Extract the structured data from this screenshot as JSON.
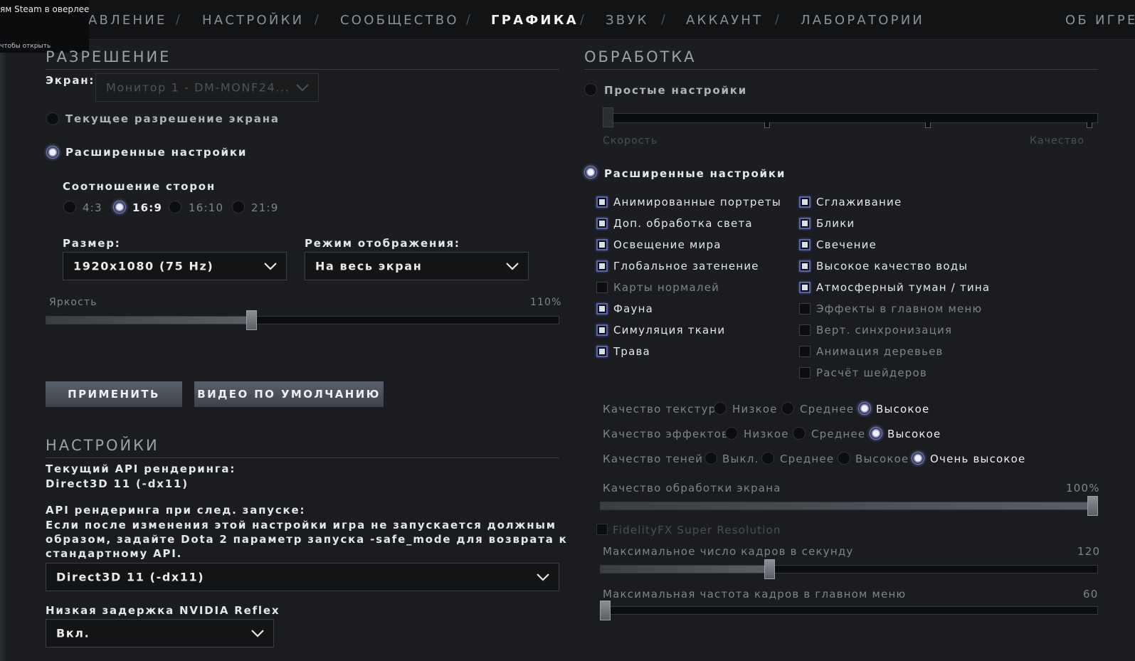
{
  "overlay": {
    "notice": "ям Steam в оверлее",
    "hint": "чтобы открыть"
  },
  "nav": {
    "items": [
      "АВЛЕНИЕ",
      "НАСТРОЙКИ",
      "СООБЩЕСТВО",
      "ГРАФИКА",
      "ЗВУК",
      "АККАУНТ",
      "ЛАБОРАТОРИИ"
    ],
    "separator": "/",
    "active": "ГРАФИКА",
    "about": "ОБ ИГРЕ"
  },
  "resolution": {
    "title": "РАЗРЕШЕНИЕ",
    "screen_label": "Экран:",
    "screen_value": "Монитор 1 - DM-MONF24...",
    "current_res": "Текущее разрешение экрана",
    "advanced": "Расширенные настройки",
    "aspect_label": "Соотношение сторон",
    "aspects": [
      "4:3",
      "16:9",
      "16:10",
      "21:9"
    ],
    "aspect_selected": "16:9",
    "size_label": "Размер:",
    "size_value": "1920x1080 (75 Hz)",
    "mode_label": "Режим отображения:",
    "mode_value": "На весь экран",
    "brightness_label": "Яркость",
    "brightness_value": "110%",
    "brightness_fraction": 0.4,
    "apply": "ПРИМЕНИТЬ",
    "defaults": "ВИДЕО ПО УМОЛЧАНИЮ"
  },
  "settings": {
    "title": "НАСТРОЙКИ",
    "api_current_label": "Текущий API рендеринга:",
    "api_current_value": "Direct3D 11 (-dx11)",
    "api_next_label": "API рендеринга при след. запуске:",
    "api_warning_1": "Если после изменения этой настройки игра не запускается должным",
    "api_warning_2": "образом, задайте Dota 2 параметр запуска -safe_mode для возврата к",
    "api_warning_3": "стандартному API.",
    "api_select": "Direct3D 11 (-dx11)",
    "reflex_label": "Низкая задержка NVIDIA Reflex",
    "reflex_value": "Вкл."
  },
  "rendering": {
    "title": "ОБРАБОТКА",
    "simple": "Простые настройки",
    "speed": "Скорость",
    "quality": "Качество",
    "advanced": "Расширенные настройки",
    "left_checks": [
      {
        "label": "Анимированные портреты",
        "checked": true
      },
      {
        "label": "Доп. обработка света",
        "checked": true
      },
      {
        "label": "Освещение мира",
        "checked": true
      },
      {
        "label": "Глобальное затенение",
        "checked": true
      },
      {
        "label": "Карты нормалей",
        "checked": false
      },
      {
        "label": "Фауна",
        "checked": true
      },
      {
        "label": "Симуляция ткани",
        "checked": true
      },
      {
        "label": "Трава",
        "checked": true
      }
    ],
    "right_checks": [
      {
        "label": "Сглаживание",
        "checked": true
      },
      {
        "label": "Блики",
        "checked": true
      },
      {
        "label": "Свечение",
        "checked": true
      },
      {
        "label": "Высокое качество воды",
        "checked": true
      },
      {
        "label": "Атмосферный туман / тина",
        "checked": true
      },
      {
        "label": "Эффекты в главном меню",
        "checked": false
      },
      {
        "label": "Верт. синхронизация",
        "checked": false
      },
      {
        "label": "Анимация деревьев",
        "checked": false
      },
      {
        "label": "Расчёт шейдеров",
        "checked": false
      }
    ],
    "texture_label": "Качество текстур",
    "texture_opts": [
      "Низкое",
      "Среднее",
      "Высокое"
    ],
    "effects_label": "Качество эффектов",
    "effects_opts": [
      "Низкое",
      "Среднее",
      "Высокое"
    ],
    "shadow_label": "Качество теней",
    "shadow_opts": [
      "Выкл.",
      "Среднее",
      "Высокое",
      "Очень высокое"
    ],
    "screen_quality_label": "Качество обработки экрана",
    "screen_quality_value": "100%",
    "fsr_label": "FidelityFX Super Resolution",
    "fps_label": "Максимальное число кадров в секунду",
    "fps_value": "120",
    "fps_fraction": 0.34,
    "menu_fps_label": "Максимальная частота кадров в главном меню",
    "menu_fps_value": "60"
  }
}
